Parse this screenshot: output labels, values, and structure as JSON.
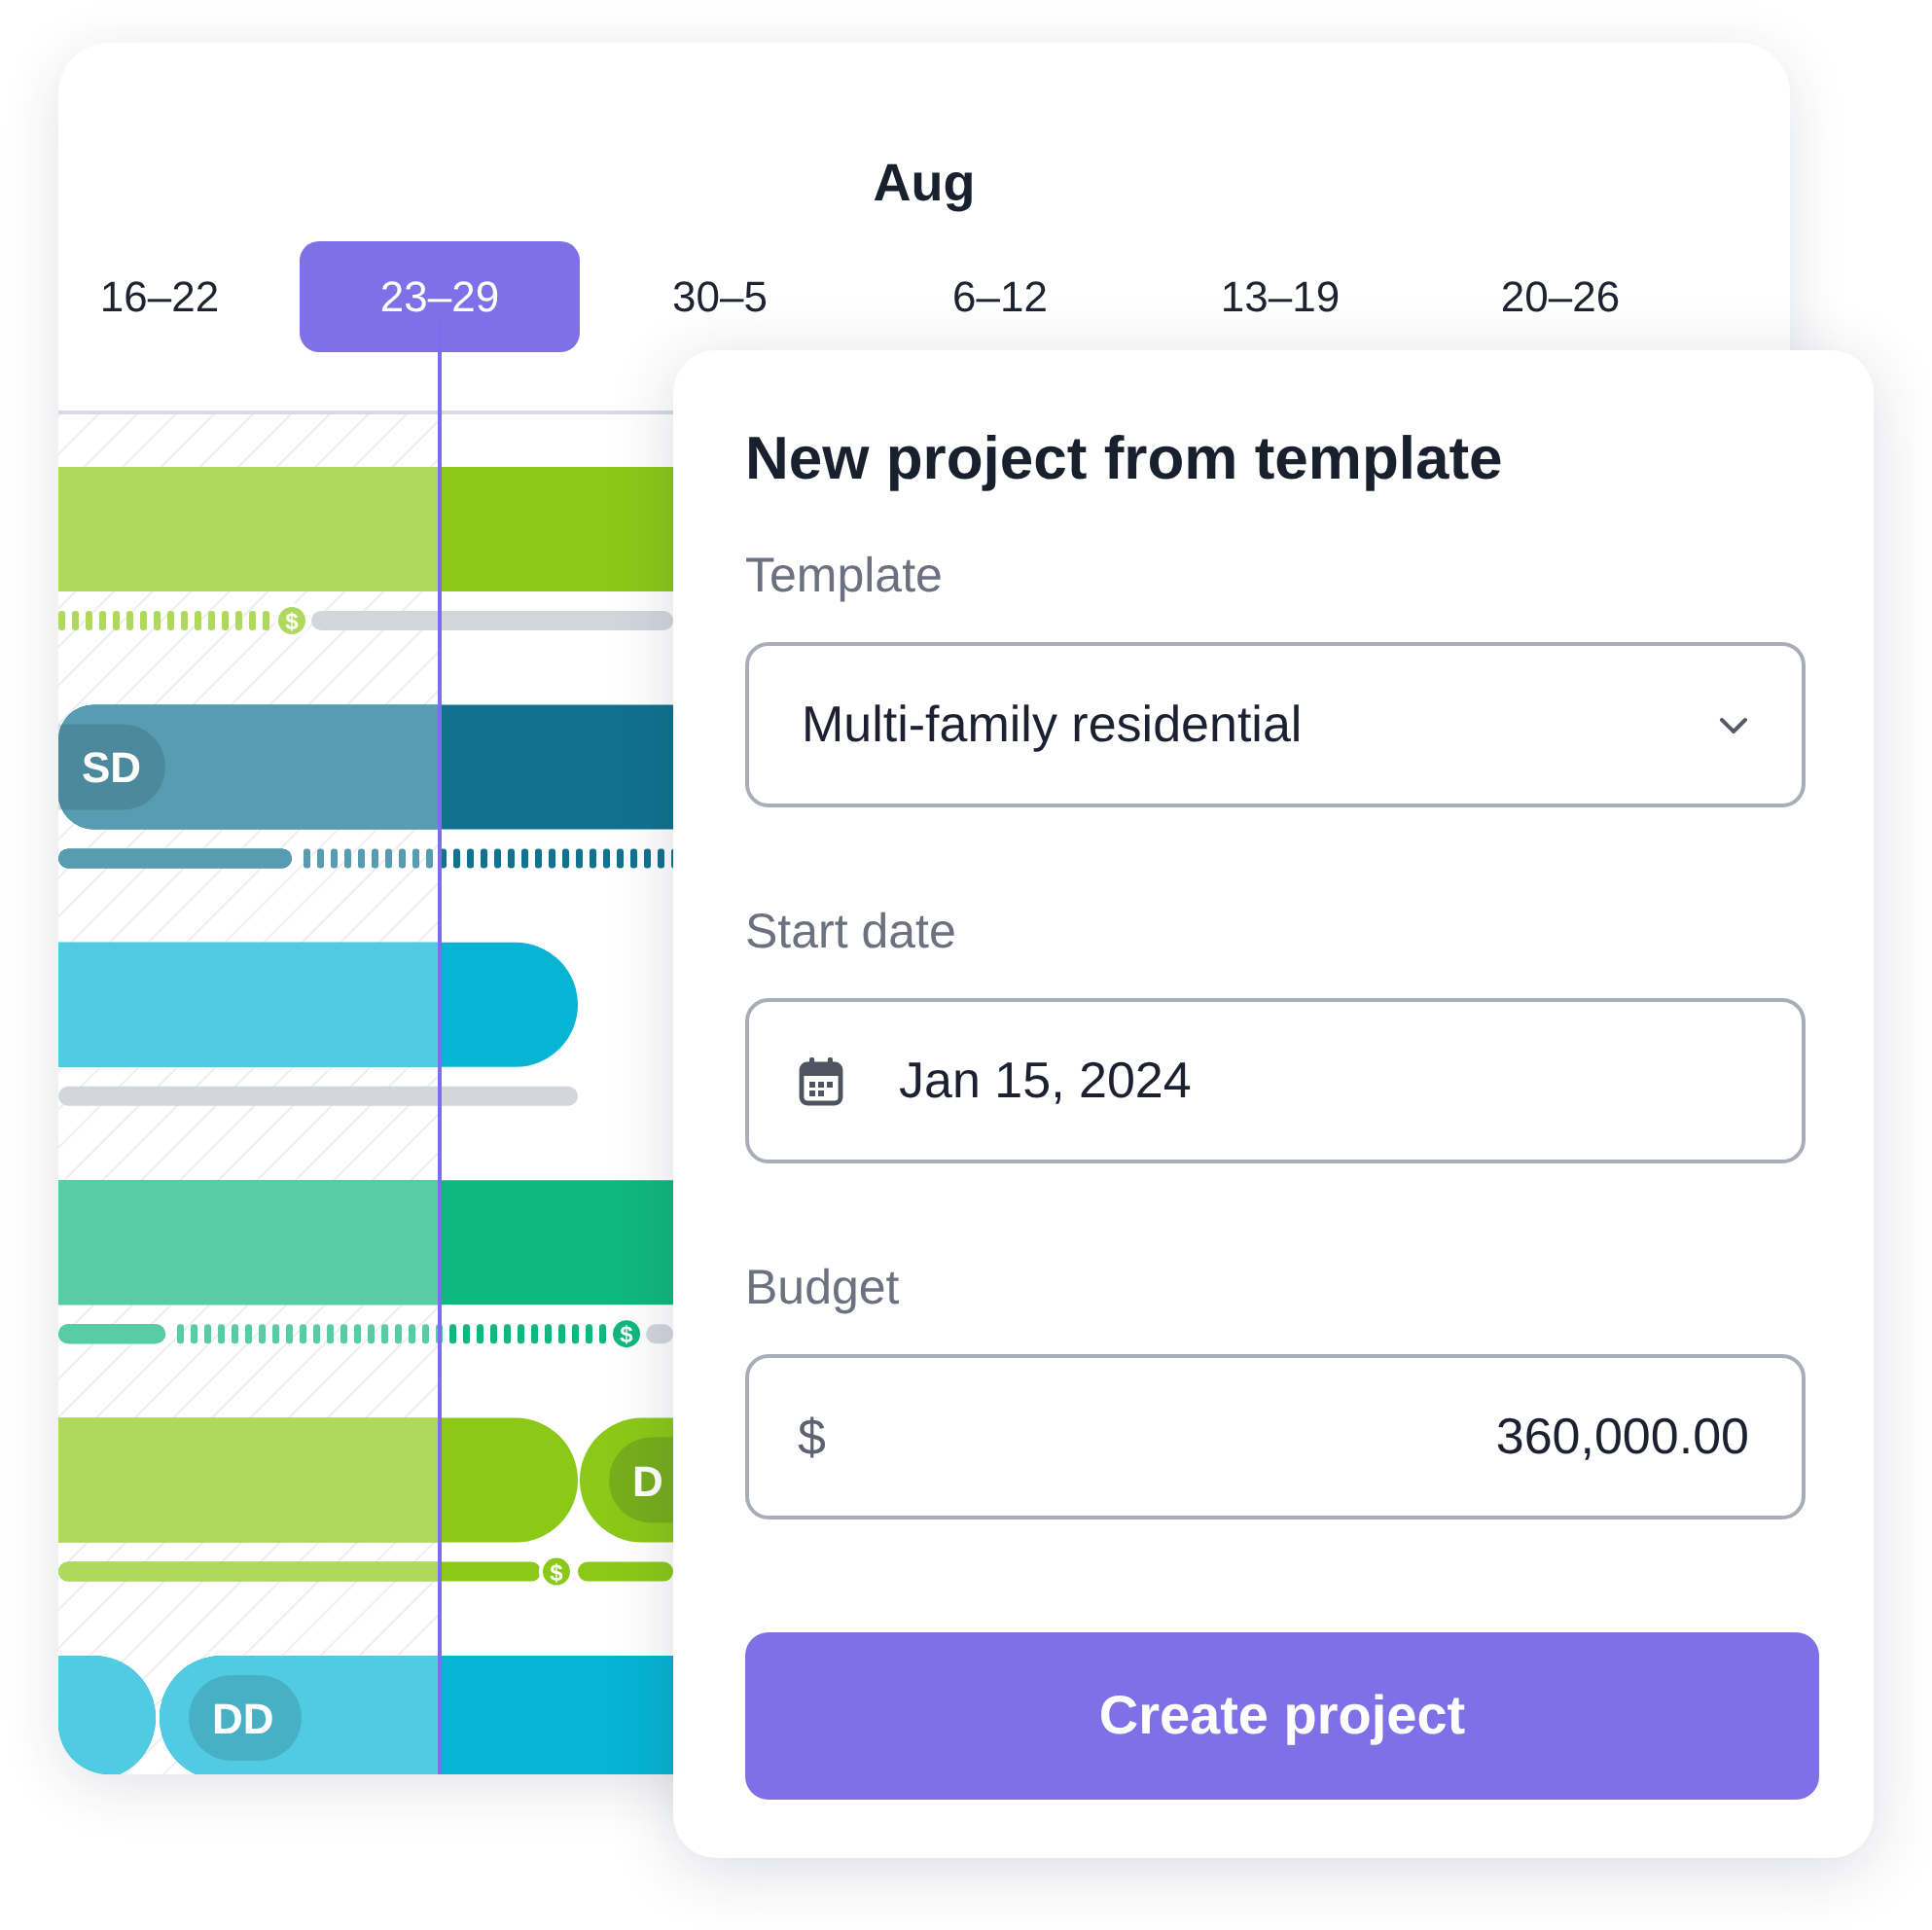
{
  "timeline": {
    "month": "Aug",
    "weeks": [
      {
        "label": "16–22",
        "selected": false
      },
      {
        "label": "23–29",
        "selected": true
      },
      {
        "label": "30–5",
        "selected": false
      },
      {
        "label": "6–12",
        "selected": false
      },
      {
        "label": "13–19",
        "selected": false
      },
      {
        "label": "20–26",
        "selected": false
      }
    ]
  },
  "gantt": {
    "rows": [
      {
        "color": "#8bc918",
        "marker": "$"
      },
      {
        "color": "#10728f",
        "tag": "SD"
      },
      {
        "color": "#07b4d4"
      },
      {
        "color": "#10b87f",
        "marker": "$"
      },
      {
        "color": "#8bc918",
        "marker": "$",
        "tag": "D"
      },
      {
        "color": "#07b4d4",
        "tag": "DD"
      }
    ]
  },
  "dialog": {
    "title": "New project from template",
    "fields": [
      {
        "kind": "select",
        "label": "Template",
        "value": "Multi-family residential"
      },
      {
        "kind": "date",
        "label": "Start date",
        "value": "Jan 15, 2024"
      },
      {
        "kind": "currency",
        "label": "Budget",
        "prefix": "$",
        "value": "360,000.00"
      }
    ],
    "submit": "Create project"
  }
}
